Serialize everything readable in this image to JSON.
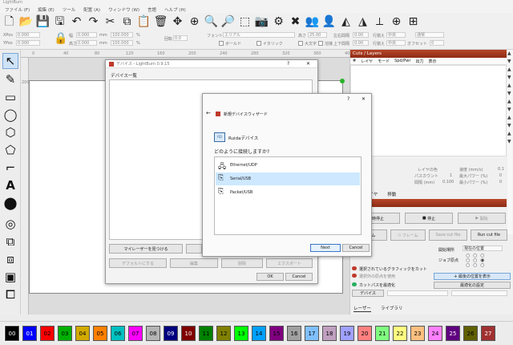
{
  "app": {
    "title": "LightBurn"
  },
  "menu": [
    "ファイル (F)",
    "編集 (E)",
    "ツール",
    "配置 (A)",
    "ウィンドウ (W)",
    "言語",
    "ヘルプ (H)"
  ],
  "props": {
    "xpos_label": "XPos",
    "xpos_value": "0.000",
    "ypos_label": "YPos",
    "ypos_value": "0.000",
    "width_label": "幅",
    "width_value": "0.000",
    "height_label": "高さ",
    "height_value": "0.000",
    "unit": "mm",
    "pct1": "100.000",
    "pct2": "100.000",
    "rotate_label": "回転",
    "rotate_value": "0.0",
    "font_label": "フォント",
    "font_value": "エリアル",
    "height2_label": "高さ",
    "height2_value": "25.00",
    "hspace_label": "左右間隔",
    "hspace_value": "0.00",
    "vspace_label": "上下間隔",
    "vspace_value": "0.00",
    "halign_label": "行揃え",
    "halign_value": "中央",
    "valign_label": "行揃え",
    "valign_value": "中央",
    "mode_label": "通常",
    "offset_label": "オフセット",
    "offset_value": "0",
    "bold_label": "ボールド",
    "italic_label": "イタリック",
    "upper_label": "大文字",
    "weld_label": "溶接",
    "distort_label": "歪み"
  },
  "rulers": {
    "top": [
      "0",
      "40",
      "80",
      "120",
      "160",
      "200",
      "240",
      "280",
      "320",
      "360",
      "400"
    ],
    "left_top": "200"
  },
  "cuts": {
    "header": "Cuts / Layers",
    "columns": [
      "#",
      "レイヤ",
      "モード",
      "Spd/Pwr",
      "出力",
      "表示"
    ],
    "layer_color_label": "レイヤの色",
    "pass_label": "パスカウント",
    "pass_value": "1",
    "spacing_label": "間隔 (mm)",
    "spacing_value": "0.100",
    "speed_label": "速度 (mm/s)",
    "speed_value": "0.1",
    "maxpow_label": "最大パワー (%)",
    "maxpow_value": "0",
    "minpow_label": "最小パワー (%)",
    "minpow_value": "0",
    "tabs": [
      "レイヤ",
      "移動"
    ]
  },
  "laser": {
    "pause_label": "一時停止",
    "stop_label": "停止",
    "start_label": "開始",
    "home_label": "ホーム",
    "frame_label": "フレーム",
    "save_label": "Save cut file",
    "run_label": "Run cut file",
    "start_from_label": "開始場所",
    "start_from_value": "現在の位置",
    "job_origin_label": "ジョブ原点",
    "opt1": "選択されているグラフィックをカット",
    "opt2": "選択外の原点を使用",
    "opt3": "カットパスを最適化",
    "show_pos": "最後の位置を表示",
    "opt_settings": "最適化の設定",
    "device_label": "デバイス",
    "tabs": [
      "レーザー",
      "ライブラリ"
    ]
  },
  "devices": {
    "title": "デバイス - LightBurn 0.9.15",
    "list_label": "デバイス一覧",
    "find_btn": "マイレーザーを見つける",
    "default_btn": "デフォルトにする",
    "edit_btn": "編集",
    "delete_btn": "削除",
    "export_btn": "エクスポート",
    "ok_btn": "OK",
    "cancel_btn": "Cancel",
    "help": "?",
    "close": "✕"
  },
  "wizard": {
    "title": "新規デバイスウィザード",
    "device_name": "Ruidaデバイス",
    "question": "どのように接続しますか?",
    "options": [
      "Ethernet/UDP",
      "Serial/USB",
      "Packet/USB"
    ],
    "selected": "Serial/USB",
    "next_btn": "Next",
    "cancel_btn": "Cancel",
    "help": "?",
    "close": "✕",
    "back": "←"
  },
  "palette": {
    "labels": [
      "00",
      "01",
      "02",
      "03",
      "04",
      "05",
      "06",
      "07",
      "08",
      "09",
      "10",
      "11",
      "12",
      "13",
      "14",
      "15",
      "16",
      "17",
      "18",
      "19",
      "20",
      "21",
      "22",
      "23",
      "24",
      "25",
      "26",
      "27"
    ],
    "colors": [
      "#000000",
      "#0000ff",
      "#ff0000",
      "#00b000",
      "#d2aa00",
      "#ff8000",
      "#00c0c0",
      "#ff00ff",
      "#b4b4b4",
      "#000080",
      "#800000",
      "#008000",
      "#808000",
      "#00ff00",
      "#00a0ff",
      "#800080",
      "#a0a0a0",
      "#80c0ff",
      "#c0a0c0",
      "#a0a0ff",
      "#ff8080",
      "#80ff80",
      "#ffff80",
      "#ffc080",
      "#ff80ff",
      "#600080",
      "#606000",
      "#a03030"
    ],
    "text_light": [
      "00",
      "01",
      "09",
      "10",
      "25",
      "27"
    ]
  }
}
